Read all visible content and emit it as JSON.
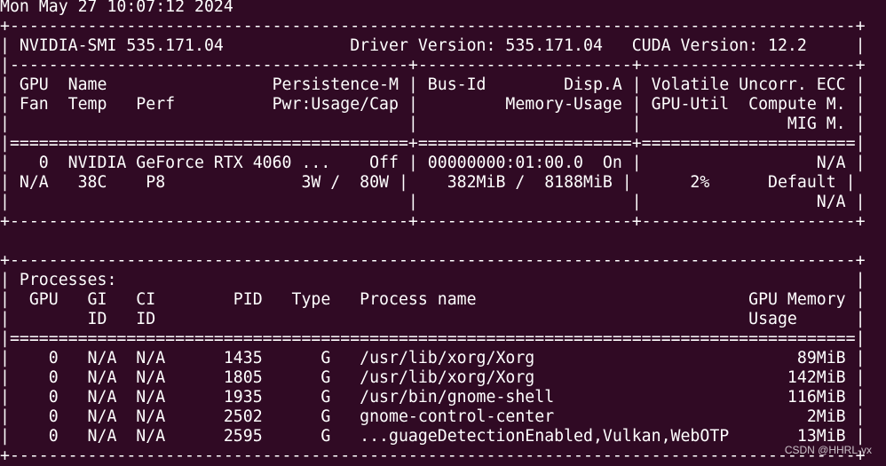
{
  "colors": {
    "background": "#300a24",
    "foreground": "#ffffff"
  },
  "lines": [
    "Mon May 27 10:07:12 2024",
    "+---------------------------------------------------------------------------------------+",
    "| NVIDIA-SMI 535.171.04             Driver Version: 535.171.04   CUDA Version: 12.2     |",
    "|-----------------------------------------+----------------------+----------------------+",
    "| GPU  Name                 Persistence-M | Bus-Id        Disp.A | Volatile Uncorr. ECC |",
    "| Fan  Temp   Perf          Pwr:Usage/Cap |         Memory-Usage | GPU-Util  Compute M. |",
    "|                                         |                      |               MIG M. |",
    "|=========================================+======================+======================|",
    "|   0  NVIDIA GeForce RTX 4060 ...    Off | 00000000:01:00.0  On |                  N/A |",
    "| N/A   38C    P8              3W /  80W |    382MiB /  8188MiB |      2%      Default |",
    "|                                         |                      |                  N/A |",
    "+-----------------------------------------+----------------------+----------------------+",
    "",
    "+---------------------------------------------------------------------------------------+",
    "| Processes:                                                                            |",
    "|  GPU   GI   CI        PID   Type   Process name                            GPU Memory |",
    "|        ID   ID                                                             Usage      |",
    "|=======================================================================================|",
    "|    0   N/A  N/A      1435      G   /usr/lib/xorg/Xorg                           89MiB |",
    "|    0   N/A  N/A      1805      G   /usr/lib/xorg/Xorg                          142MiB |",
    "|    0   N/A  N/A      1935      G   /usr/bin/gnome-shell                        116MiB |",
    "|    0   N/A  N/A      2502      G   gnome-control-center                          2MiB |",
    "|    0   N/A  N/A      2595      G   ...guageDetectionEnabled,Vulkan,WebOTP       13MiB |",
    "+---------------------------------------------------------------------------------------+"
  ],
  "watermark": "CSDN @HHRL-yx"
}
